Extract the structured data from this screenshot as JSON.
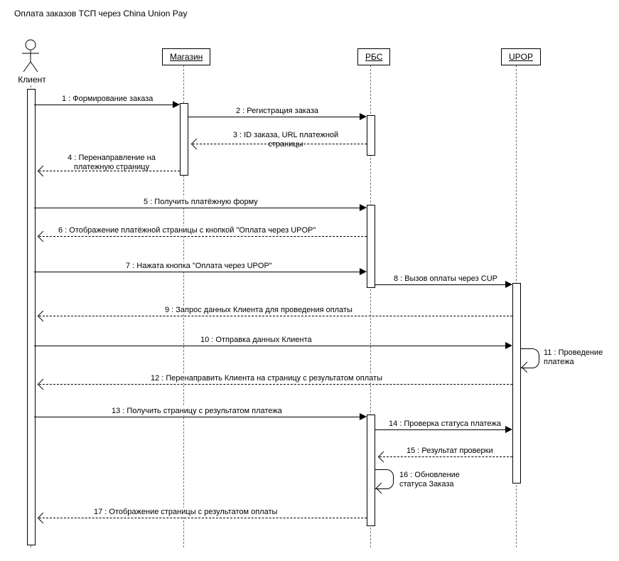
{
  "title": "Оплата заказов ТСП через China Union Pay",
  "participants": {
    "client": "Клиент",
    "shop": "Магазин",
    "rbs": "РБС",
    "upop": "UPOP"
  },
  "messages": {
    "m1": "1 : Формирование заказа",
    "m2": "2 : Регистрация заказа",
    "m3": "3 : ID заказа, URL платежной страницы",
    "m4": "4 : Перенаправление на платежную страницу",
    "m5": "5 : Получить платёжную форму",
    "m6": "6 : Отображение платёжной страницы с кнопкой \"Оплата через UPOP\"",
    "m7": "7 : Нажата кнопка \"Оплата через UPOP\"",
    "m8": "8 : Вызов оплаты через CUP",
    "m9": "9 : Запрос данных Клиента для проведения оплаты",
    "m10": "10 : Отправка данных Клиента",
    "m11": "11 : Проведение платежа",
    "m12": "12 : Перенаправить Клиента на страницу с результатом оплаты",
    "m13": "13 : Получить страницу с результатом платежа",
    "m14": "14 : Проверка статуса платежа",
    "m15": "15 : Результат проверки",
    "m16": "16 : Обновление статуса  Заказа",
    "m17": "17 : Отображение страницы с результатом оплаты"
  }
}
